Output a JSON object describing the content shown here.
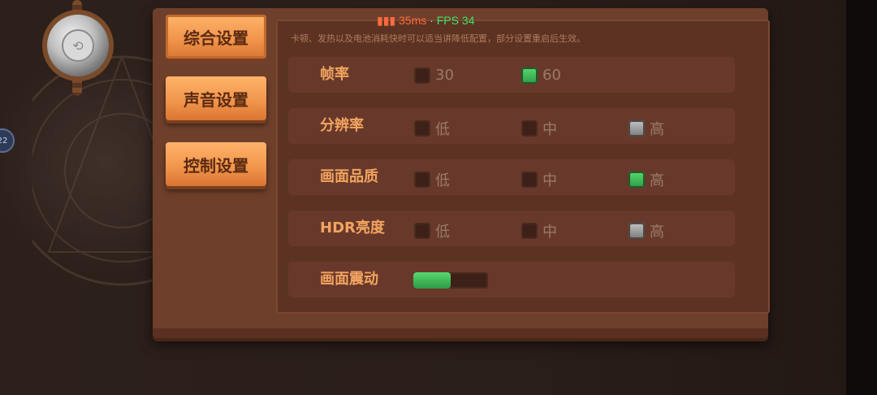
{
  "hud": {
    "ping": "35ms",
    "separator": "·",
    "fps": "FPS 34"
  },
  "tabs": [
    {
      "label": "综合设置",
      "active": true
    },
    {
      "label": "声音设置",
      "active": false
    },
    {
      "label": "控制设置",
      "active": false
    }
  ],
  "tip": "卡顿、发热以及电池消耗快时可以适当讲降低配置，部分设置重启后生效。",
  "settings": {
    "frame_rate": {
      "label": "帧率",
      "options": [
        "30",
        "60"
      ],
      "selected": "60"
    },
    "resolution": {
      "label": "分辨率",
      "options": [
        "低",
        "中",
        "高"
      ],
      "selected": "高"
    },
    "quality": {
      "label": "画面品质",
      "options": [
        "低",
        "中",
        "高"
      ],
      "selected": "高"
    },
    "hdr": {
      "label": "HDR亮度",
      "options": [
        "低",
        "中",
        "高"
      ],
      "selected": "高"
    },
    "vibration": {
      "label": "画面震动",
      "level": 0.5
    }
  },
  "side_badge": "22",
  "colors": {
    "selected_green": "#3fbf5a",
    "selected_gray": "#a0a0a0",
    "accent_orange": "#f2a460"
  }
}
